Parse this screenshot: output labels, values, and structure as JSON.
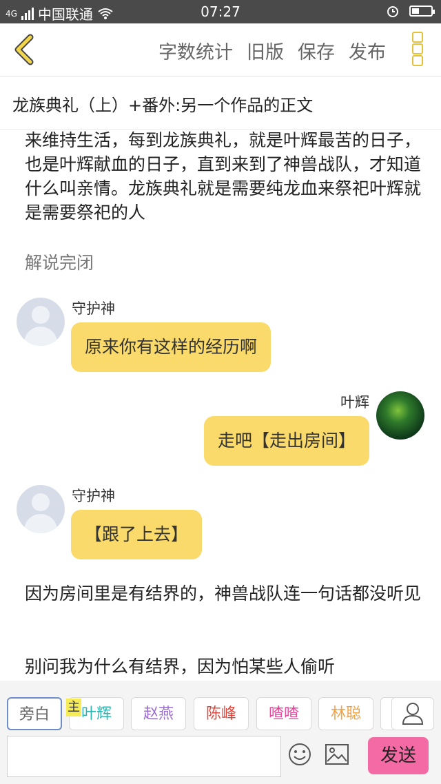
{
  "status_bar": {
    "network": "4G",
    "carrier": "中国联通",
    "time": "07:27"
  },
  "toolbar": {
    "word_count": "字数统计",
    "old_version": "旧版",
    "save": "保存",
    "publish": "发布"
  },
  "work_title": "龙族典礼（上）+番外:另一个作品的正文",
  "content": {
    "intro": "来维持生活，每到龙族典礼，就是叶辉最苦的日子，也是叶辉献血的日子，直到来到了神兽战队，才知道什么叫亲情。龙族典礼就是需要纯龙血来祭祀叶辉就是需要祭祀的人",
    "narration_end": "解说完闭",
    "messages": [
      {
        "speaker": "守护神",
        "text": "原来你有这样的经历啊",
        "side": "left"
      },
      {
        "speaker": "叶辉",
        "text": "走吧【走出房间】",
        "side": "right"
      },
      {
        "speaker": "守护神",
        "text": "【跟了上去】",
        "side": "left"
      }
    ],
    "para_1": "因为房间里是有结界的，神兽战队连一句话都没听见",
    "para_2": "别问我为什么有结界，因为怕某些人偷听"
  },
  "characters": [
    {
      "label": "旁白",
      "color": "#888888"
    },
    {
      "label": "叶辉",
      "color": "#2bb5b0"
    },
    {
      "label": "赵燕",
      "color": "#9b6fd1"
    },
    {
      "label": "陈峰",
      "color": "#e0463a"
    },
    {
      "label": "喳喳",
      "color": "#e64a9a"
    },
    {
      "label": "林聪",
      "color": "#f0a44a"
    }
  ],
  "main_marker": "主",
  "input": {
    "value": "",
    "placeholder": ""
  },
  "send_label": "发送",
  "colors": {
    "bubble": "#f9da6b",
    "send": "#f36aa4",
    "accent": "#e3c23a"
  }
}
